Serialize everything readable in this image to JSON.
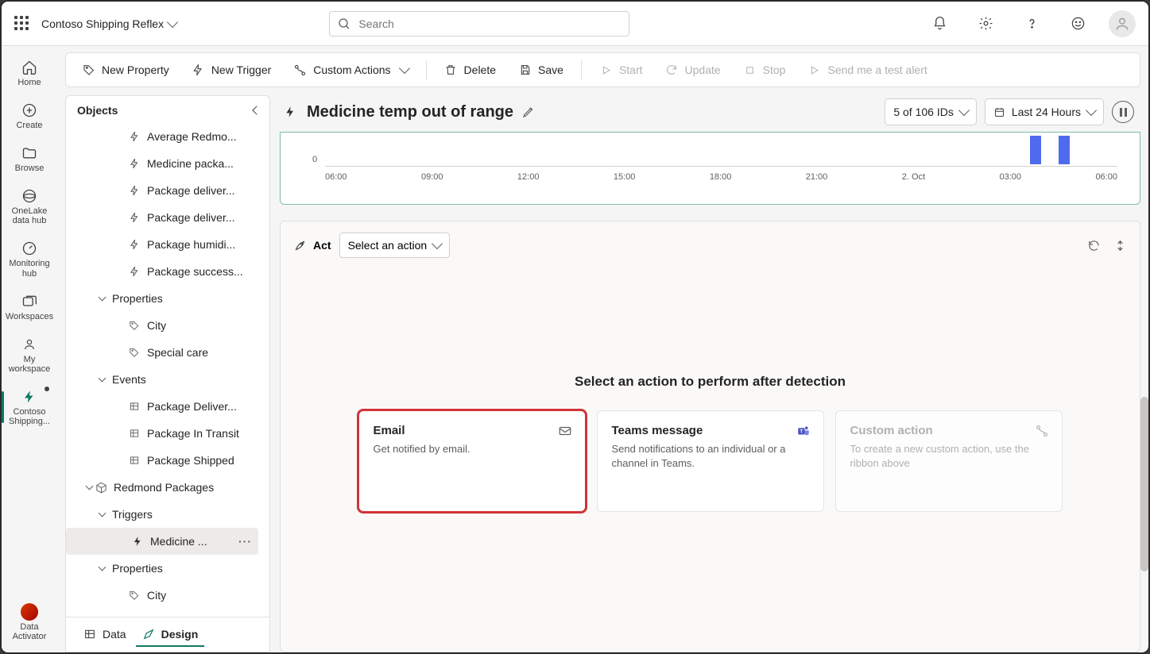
{
  "header": {
    "breadcrumb": "Contoso Shipping Reflex",
    "search_placeholder": "Search"
  },
  "left_rail": {
    "home": "Home",
    "create": "Create",
    "browse": "Browse",
    "onelake": "OneLake data hub",
    "monitoring": "Monitoring hub",
    "workspaces": "Workspaces",
    "my_workspace": "My workspace",
    "current": "Contoso Shipping...",
    "data_activator": "Data Activator"
  },
  "toolbar": {
    "new_property": "New Property",
    "new_trigger": "New Trigger",
    "custom_actions": "Custom Actions",
    "delete": "Delete",
    "save": "Save",
    "start": "Start",
    "update": "Update",
    "stop": "Stop",
    "test_alert": "Send me a test alert"
  },
  "objects": {
    "title": "Objects",
    "items": [
      {
        "label": "Average Redmo...",
        "icon": "bolt",
        "level": "lvl1"
      },
      {
        "label": "Medicine packa...",
        "icon": "bolt",
        "level": "lvl1"
      },
      {
        "label": "Package deliver...",
        "icon": "bolt",
        "level": "lvl1"
      },
      {
        "label": "Package deliver...",
        "icon": "bolt",
        "level": "lvl1"
      },
      {
        "label": "Package humidi...",
        "icon": "bolt",
        "level": "lvl1"
      },
      {
        "label": "Package success...",
        "icon": "bolt",
        "level": "lvl1"
      },
      {
        "label": "Properties",
        "icon": "expander",
        "level": "lvlh2",
        "header": true
      },
      {
        "label": "City",
        "icon": "tag",
        "level": "lvl2"
      },
      {
        "label": "Special care",
        "icon": "tag",
        "level": "lvl2"
      },
      {
        "label": "Events",
        "icon": "expander",
        "level": "lvlh2",
        "header": true
      },
      {
        "label": "Package Deliver...",
        "icon": "table",
        "level": "lvl2"
      },
      {
        "label": "Package In Transit",
        "icon": "table",
        "level": "lvl2"
      },
      {
        "label": "Package Shipped",
        "icon": "table",
        "level": "lvl2"
      },
      {
        "label": "Redmond Packages",
        "icon": "cube",
        "level": "lvlh1",
        "header": true
      },
      {
        "label": "Triggers",
        "icon": "expander",
        "level": "lvlh2",
        "header": true
      },
      {
        "label": "Medicine ...",
        "icon": "bolt-filled",
        "level": "lvl3",
        "selected": true,
        "more": true
      },
      {
        "label": "Properties",
        "icon": "expander",
        "level": "lvlh2",
        "header": true
      },
      {
        "label": "City",
        "icon": "tag",
        "level": "lvl2"
      }
    ]
  },
  "bottom_tabs": {
    "data": "Data",
    "design": "Design"
  },
  "editor": {
    "title": "Medicine temp out of range",
    "ids_pill": "5 of 106 IDs",
    "time_pill": "Last 24 Hours"
  },
  "chart_data": {
    "type": "bar",
    "y_axis_zero": "0",
    "x_ticks": [
      "06:00",
      "09:00",
      "12:00",
      "15:00",
      "18:00",
      "21:00",
      "2. Oct",
      "03:00",
      "06:00"
    ],
    "bars": [
      {
        "x_percent": 87.2,
        "height": 36
      },
      {
        "x_percent": 90.6,
        "height": 36
      }
    ]
  },
  "act": {
    "label": "Act",
    "select_placeholder": "Select an action",
    "heading": "Select an action to perform after detection",
    "cards": [
      {
        "title": "Email",
        "desc": "Get notified by email."
      },
      {
        "title": "Teams message",
        "desc": "Send notifications to an individual or a channel in Teams."
      },
      {
        "title": "Custom action",
        "desc": "To create a new custom action, use the ribbon above"
      }
    ]
  }
}
